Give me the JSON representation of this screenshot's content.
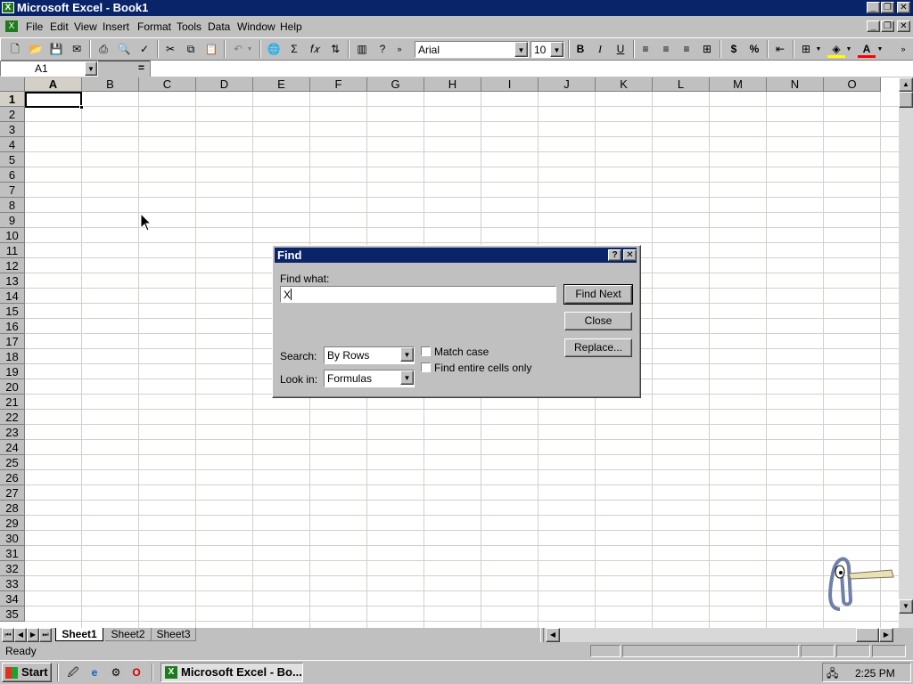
{
  "window": {
    "title": "Microsoft Excel - Book1"
  },
  "menu": [
    "File",
    "Edit",
    "View",
    "Insert",
    "Format",
    "Tools",
    "Data",
    "Window",
    "Help"
  ],
  "toolbar": {
    "font": "Arial",
    "size": "10"
  },
  "formula": {
    "namebox": "A1",
    "equals": "="
  },
  "columns": [
    "A",
    "B",
    "C",
    "D",
    "E",
    "F",
    "G",
    "H",
    "I",
    "J",
    "K",
    "L",
    "M",
    "N",
    "O"
  ],
  "rows": [
    "1",
    "2",
    "3",
    "4",
    "5",
    "6",
    "7",
    "8",
    "9",
    "10",
    "11",
    "12",
    "13",
    "14",
    "15",
    "16",
    "17",
    "18",
    "19",
    "20",
    "21",
    "22",
    "23",
    "24",
    "25",
    "26",
    "27",
    "28",
    "29",
    "30",
    "31",
    "32",
    "33",
    "34",
    "35"
  ],
  "sheets": [
    "Sheet1",
    "Sheet2",
    "Sheet3"
  ],
  "status": "Ready",
  "dialog": {
    "title": "Find",
    "help": "?",
    "close_x": "✕",
    "find_what_label": "Find what:",
    "find_what_value": "X",
    "find_next": "Find Next",
    "close": "Close",
    "replace": "Replace...",
    "search_label": "Search:",
    "search_value": "By Rows",
    "lookin_label": "Look in:",
    "lookin_value": "Formulas",
    "match_case": "Match case",
    "entire_cells": "Find entire cells only"
  },
  "taskbar": {
    "start": "Start",
    "app": "Microsoft Excel - Bo...",
    "clock": "2:25 PM"
  }
}
